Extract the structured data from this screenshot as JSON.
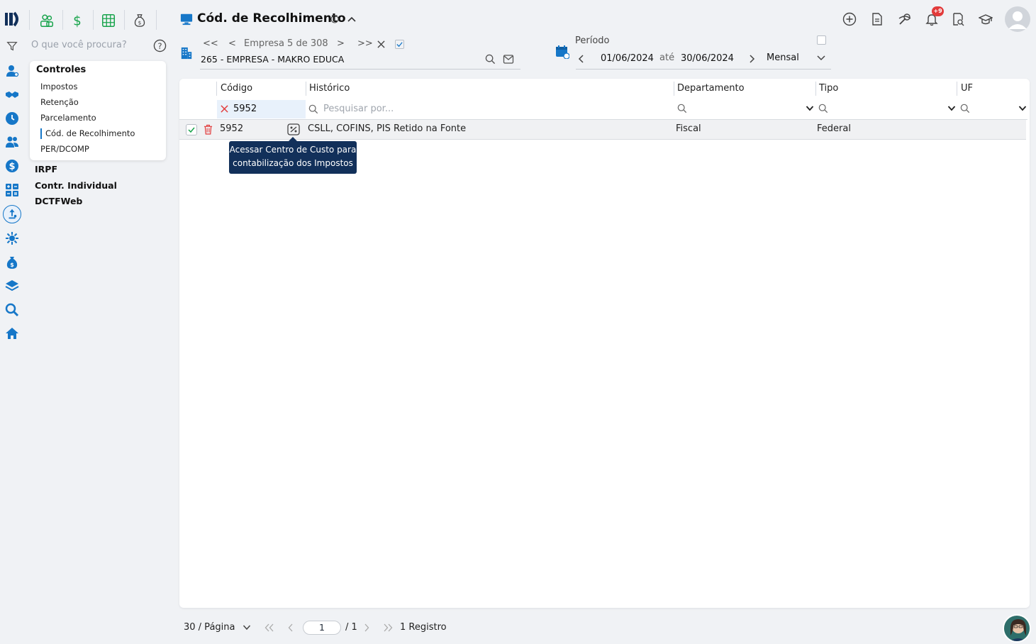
{
  "brand": {
    "logo": "logo-icon"
  },
  "modules": [
    {
      "icon": "people-icon",
      "color": "#16a34a"
    },
    {
      "icon": "dollar-icon",
      "color": "#16a34a"
    },
    {
      "icon": "spreadsheet-icon",
      "color": "#16a34a"
    },
    {
      "icon": "money-bag-icon",
      "color": "#444444"
    }
  ],
  "search": {
    "placeholder": "O que você procura?"
  },
  "menu": {
    "title": "Controles",
    "items": [
      "Impostos",
      "Retenção",
      "Parcelamento",
      "Cód. de Recolhimento",
      "PER/DCOMP"
    ],
    "active": "Cód. de Recolhimento",
    "sections": [
      "IRPF",
      "Contr. Individual",
      "DCTFWeb"
    ]
  },
  "page": {
    "title": "Cód. de Recolhimento"
  },
  "company": {
    "nav_first": "<<",
    "nav_prev": "<",
    "counter": "Empresa 5 de 308",
    "nav_next": ">",
    "nav_last": ">>",
    "name": "265 - EMPRESA - MAKRO EDUCA"
  },
  "period": {
    "label": "Período",
    "start": "01/06/2024",
    "separator": "até",
    "end": "30/06/2024",
    "mode": "Mensal"
  },
  "notifications": {
    "badge": "+9"
  },
  "table": {
    "columns": [
      "Código",
      "Histórico",
      "Departamento",
      "Tipo",
      "UF"
    ],
    "filters": {
      "codigo": "5952",
      "historico_placeholder": "Pesquisar por..."
    },
    "rows": [
      {
        "codigo": "5952",
        "historico": "CSLL, COFINS, PIS Retido na Fonte",
        "departamento": "Fiscal",
        "tipo": "Federal",
        "uf": ""
      }
    ],
    "tooltip_line1": "Acessar Centro de Custo para",
    "tooltip_line2": "contabilização dos Impostos"
  },
  "footer": {
    "per_page": "30 / Página",
    "page": "1",
    "total_pages": "/ 1",
    "records": "1 Registro"
  },
  "colors": {
    "accent": "#1677c8",
    "success": "#16a34a",
    "danger": "#e23b3b",
    "tooltip": "#12305a"
  }
}
